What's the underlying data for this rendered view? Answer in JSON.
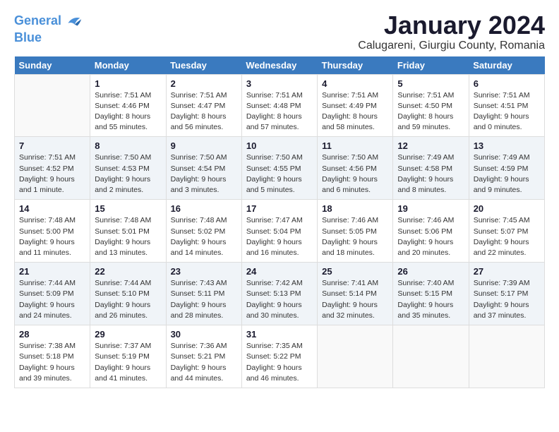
{
  "logo": {
    "line1": "General",
    "line2": "Blue"
  },
  "title": "January 2024",
  "subtitle": "Calugareni, Giurgiu County, Romania",
  "days_header": [
    "Sunday",
    "Monday",
    "Tuesday",
    "Wednesday",
    "Thursday",
    "Friday",
    "Saturday"
  ],
  "weeks": [
    [
      {
        "day": "",
        "info": ""
      },
      {
        "day": "1",
        "info": "Sunrise: 7:51 AM\nSunset: 4:46 PM\nDaylight: 8 hours\nand 55 minutes."
      },
      {
        "day": "2",
        "info": "Sunrise: 7:51 AM\nSunset: 4:47 PM\nDaylight: 8 hours\nand 56 minutes."
      },
      {
        "day": "3",
        "info": "Sunrise: 7:51 AM\nSunset: 4:48 PM\nDaylight: 8 hours\nand 57 minutes."
      },
      {
        "day": "4",
        "info": "Sunrise: 7:51 AM\nSunset: 4:49 PM\nDaylight: 8 hours\nand 58 minutes."
      },
      {
        "day": "5",
        "info": "Sunrise: 7:51 AM\nSunset: 4:50 PM\nDaylight: 8 hours\nand 59 minutes."
      },
      {
        "day": "6",
        "info": "Sunrise: 7:51 AM\nSunset: 4:51 PM\nDaylight: 9 hours\nand 0 minutes."
      }
    ],
    [
      {
        "day": "7",
        "info": "Sunrise: 7:51 AM\nSunset: 4:52 PM\nDaylight: 9 hours\nand 1 minute."
      },
      {
        "day": "8",
        "info": "Sunrise: 7:50 AM\nSunset: 4:53 PM\nDaylight: 9 hours\nand 2 minutes."
      },
      {
        "day": "9",
        "info": "Sunrise: 7:50 AM\nSunset: 4:54 PM\nDaylight: 9 hours\nand 3 minutes."
      },
      {
        "day": "10",
        "info": "Sunrise: 7:50 AM\nSunset: 4:55 PM\nDaylight: 9 hours\nand 5 minutes."
      },
      {
        "day": "11",
        "info": "Sunrise: 7:50 AM\nSunset: 4:56 PM\nDaylight: 9 hours\nand 6 minutes."
      },
      {
        "day": "12",
        "info": "Sunrise: 7:49 AM\nSunset: 4:58 PM\nDaylight: 9 hours\nand 8 minutes."
      },
      {
        "day": "13",
        "info": "Sunrise: 7:49 AM\nSunset: 4:59 PM\nDaylight: 9 hours\nand 9 minutes."
      }
    ],
    [
      {
        "day": "14",
        "info": "Sunrise: 7:48 AM\nSunset: 5:00 PM\nDaylight: 9 hours\nand 11 minutes."
      },
      {
        "day": "15",
        "info": "Sunrise: 7:48 AM\nSunset: 5:01 PM\nDaylight: 9 hours\nand 13 minutes."
      },
      {
        "day": "16",
        "info": "Sunrise: 7:48 AM\nSunset: 5:02 PM\nDaylight: 9 hours\nand 14 minutes."
      },
      {
        "day": "17",
        "info": "Sunrise: 7:47 AM\nSunset: 5:04 PM\nDaylight: 9 hours\nand 16 minutes."
      },
      {
        "day": "18",
        "info": "Sunrise: 7:46 AM\nSunset: 5:05 PM\nDaylight: 9 hours\nand 18 minutes."
      },
      {
        "day": "19",
        "info": "Sunrise: 7:46 AM\nSunset: 5:06 PM\nDaylight: 9 hours\nand 20 minutes."
      },
      {
        "day": "20",
        "info": "Sunrise: 7:45 AM\nSunset: 5:07 PM\nDaylight: 9 hours\nand 22 minutes."
      }
    ],
    [
      {
        "day": "21",
        "info": "Sunrise: 7:44 AM\nSunset: 5:09 PM\nDaylight: 9 hours\nand 24 minutes."
      },
      {
        "day": "22",
        "info": "Sunrise: 7:44 AM\nSunset: 5:10 PM\nDaylight: 9 hours\nand 26 minutes."
      },
      {
        "day": "23",
        "info": "Sunrise: 7:43 AM\nSunset: 5:11 PM\nDaylight: 9 hours\nand 28 minutes."
      },
      {
        "day": "24",
        "info": "Sunrise: 7:42 AM\nSunset: 5:13 PM\nDaylight: 9 hours\nand 30 minutes."
      },
      {
        "day": "25",
        "info": "Sunrise: 7:41 AM\nSunset: 5:14 PM\nDaylight: 9 hours\nand 32 minutes."
      },
      {
        "day": "26",
        "info": "Sunrise: 7:40 AM\nSunset: 5:15 PM\nDaylight: 9 hours\nand 35 minutes."
      },
      {
        "day": "27",
        "info": "Sunrise: 7:39 AM\nSunset: 5:17 PM\nDaylight: 9 hours\nand 37 minutes."
      }
    ],
    [
      {
        "day": "28",
        "info": "Sunrise: 7:38 AM\nSunset: 5:18 PM\nDaylight: 9 hours\nand 39 minutes."
      },
      {
        "day": "29",
        "info": "Sunrise: 7:37 AM\nSunset: 5:19 PM\nDaylight: 9 hours\nand 41 minutes."
      },
      {
        "day": "30",
        "info": "Sunrise: 7:36 AM\nSunset: 5:21 PM\nDaylight: 9 hours\nand 44 minutes."
      },
      {
        "day": "31",
        "info": "Sunrise: 7:35 AM\nSunset: 5:22 PM\nDaylight: 9 hours\nand 46 minutes."
      },
      {
        "day": "",
        "info": ""
      },
      {
        "day": "",
        "info": ""
      },
      {
        "day": "",
        "info": ""
      }
    ]
  ]
}
